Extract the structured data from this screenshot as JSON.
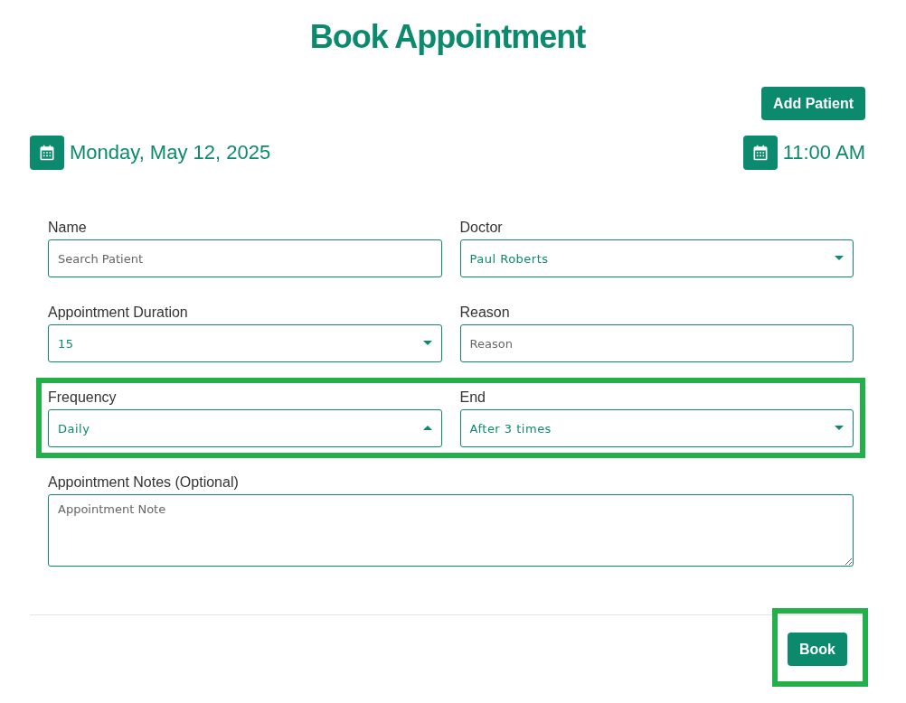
{
  "title": "Book Appointment",
  "add_patient_button": "Add Patient",
  "date": "Monday, May 12, 2025",
  "time": "11:00 AM",
  "form_rows": [
    {
      "highlighted": false,
      "fields": [
        {
          "kind": "text",
          "label": "Name",
          "placeholder": "Search Patient"
        },
        {
          "kind": "select",
          "label": "Doctor",
          "value": "Paul Roberts",
          "expanded": false
        }
      ]
    },
    {
      "highlighted": false,
      "fields": [
        {
          "kind": "select",
          "label": "Appointment Duration",
          "value": "15",
          "expanded": false
        },
        {
          "kind": "text",
          "label": "Reason",
          "placeholder": "Reason"
        }
      ]
    },
    {
      "highlighted": true,
      "fields": [
        {
          "kind": "select",
          "label": "Frequency",
          "value": "Daily",
          "expanded": true
        },
        {
          "kind": "select",
          "label": "End",
          "value": "After 3 times",
          "expanded": false
        }
      ]
    },
    {
      "highlighted": false,
      "fields": [
        {
          "kind": "textarea",
          "label": "Appointment Notes (Optional)",
          "placeholder": "Appointment Note"
        }
      ]
    }
  ],
  "book_button": {
    "label": "Book",
    "highlighted": true
  }
}
